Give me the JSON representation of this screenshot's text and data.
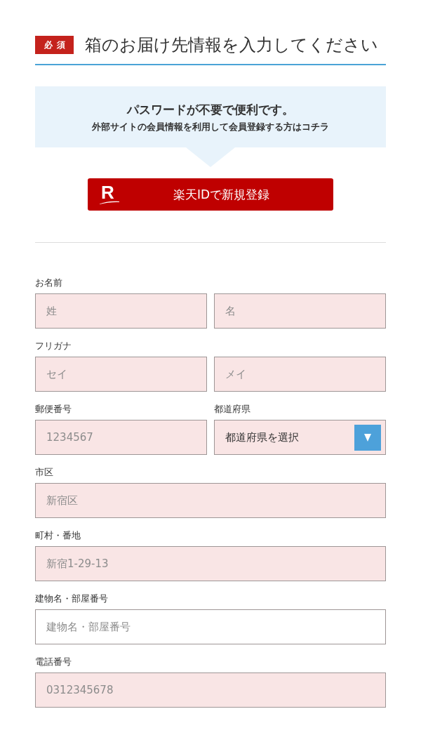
{
  "header": {
    "badge": "必須",
    "title": "箱のお届け先情報を入力してください"
  },
  "info_panel": {
    "title": "パスワードが不要で便利です。",
    "text": "外部サイトの会員情報を利用して会員登録する方はコチラ"
  },
  "signup_button": {
    "logo_letter": "R",
    "label": "楽天IDで新規登録"
  },
  "form": {
    "rows": [
      {
        "groups": [
          {
            "label": "お名前",
            "fields": [
              {
                "kind": "text",
                "placeholder": "姓",
                "required": true
              },
              {
                "kind": "text",
                "placeholder": "名",
                "required": true
              }
            ]
          }
        ]
      },
      {
        "groups": [
          {
            "label": "フリガナ",
            "fields": [
              {
                "kind": "text",
                "placeholder": "セイ",
                "required": true
              },
              {
                "kind": "text",
                "placeholder": "メイ",
                "required": true
              }
            ]
          }
        ]
      },
      {
        "groups": [
          {
            "label": "郵便番号",
            "fields": [
              {
                "kind": "text",
                "placeholder": "1234567",
                "required": true
              }
            ]
          },
          {
            "label": "都道府県",
            "fields": [
              {
                "kind": "select",
                "value": "都道府県を選択",
                "required": true
              }
            ]
          }
        ]
      },
      {
        "groups": [
          {
            "label": "市区",
            "fields": [
              {
                "kind": "text",
                "placeholder": "新宿区",
                "required": true
              }
            ]
          }
        ]
      },
      {
        "groups": [
          {
            "label": "町村・番地",
            "fields": [
              {
                "kind": "text",
                "placeholder": "新宿1-29-13",
                "required": true
              }
            ]
          }
        ]
      },
      {
        "groups": [
          {
            "label": "建物名・部屋番号",
            "fields": [
              {
                "kind": "text",
                "placeholder": "建物名・部屋番号",
                "required": false
              }
            ]
          }
        ]
      },
      {
        "groups": [
          {
            "label": "電話番号",
            "fields": [
              {
                "kind": "text",
                "placeholder": "0312345678",
                "required": true
              }
            ]
          }
        ]
      }
    ]
  }
}
